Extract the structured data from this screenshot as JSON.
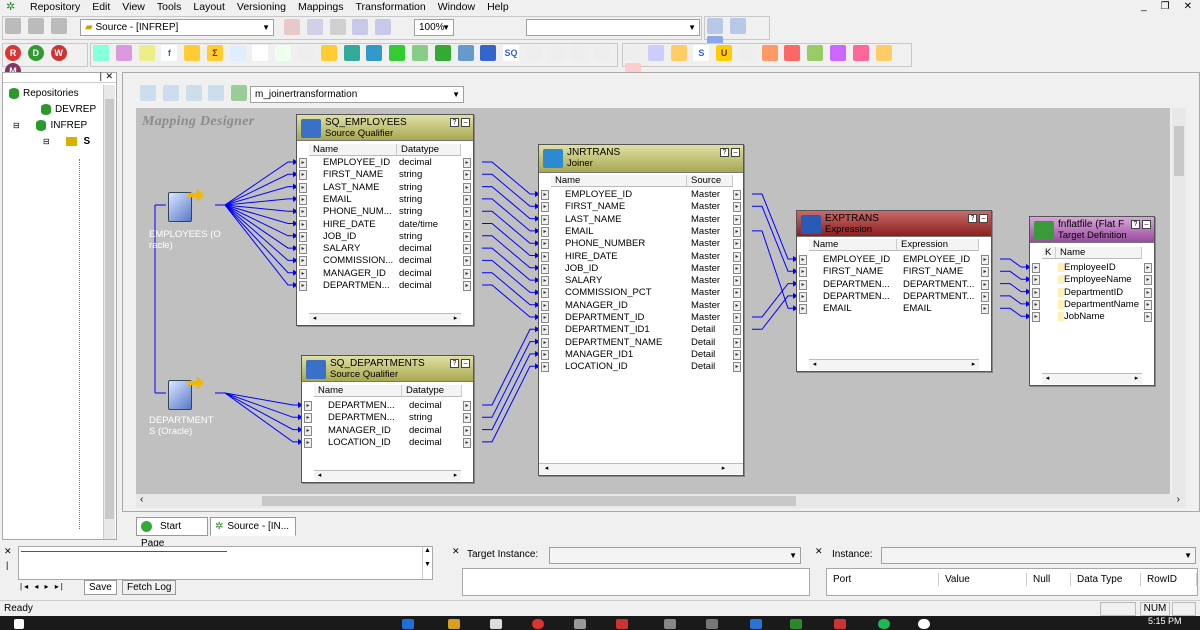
{
  "menu": [
    "Repository",
    "Edit",
    "View",
    "Tools",
    "Layout",
    "Versioning",
    "Mappings",
    "Transformation",
    "Window",
    "Help"
  ],
  "toolbar": {
    "source_combo": "Source - [INFREP]",
    "zoom_combo": "100%",
    "mapping_combo": "m_joinertransformation"
  },
  "nav": {
    "root": "Repositories",
    "items": [
      "DEVREP",
      "INFREP",
      "S"
    ]
  },
  "designer": {
    "title": "Mapping Designer",
    "sources": [
      {
        "label_lines": [
          "EMPLOYEES (O",
          "racle)"
        ]
      },
      {
        "label_lines": [
          "DEPARTMENT",
          "S (Oracle)"
        ]
      }
    ],
    "sq_employees": {
      "title": "SQ_EMPLOYEES",
      "subtitle": "Source Qualifier",
      "col_name": "Name",
      "col_type": "Datatype",
      "rows": [
        [
          "EMPLOYEE_ID",
          "decimal"
        ],
        [
          "FIRST_NAME",
          "string"
        ],
        [
          "LAST_NAME",
          "string"
        ],
        [
          "EMAIL",
          "string"
        ],
        [
          "PHONE_NUM...",
          "string"
        ],
        [
          "HIRE_DATE",
          "date/time"
        ],
        [
          "JOB_ID",
          "string"
        ],
        [
          "SALARY",
          "decimal"
        ],
        [
          "COMMISSION...",
          "decimal"
        ],
        [
          "MANAGER_ID",
          "decimal"
        ],
        [
          "DEPARTMEN...",
          "decimal"
        ]
      ]
    },
    "sq_departments": {
      "title": "SQ_DEPARTMENTS",
      "subtitle": "Source Qualifier",
      "col_name": "Name",
      "col_type": "Datatype",
      "rows": [
        [
          "DEPARTMEN...",
          "decimal"
        ],
        [
          "DEPARTMEN...",
          "string"
        ],
        [
          "MANAGER_ID",
          "decimal"
        ],
        [
          "LOCATION_ID",
          "decimal"
        ]
      ]
    },
    "joiner": {
      "title": "JNRTRANS",
      "subtitle": "Joiner",
      "col_name": "Name",
      "col_type": "Source Ty",
      "rows": [
        [
          "EMPLOYEE_ID",
          "Master"
        ],
        [
          "FIRST_NAME",
          "Master"
        ],
        [
          "LAST_NAME",
          "Master"
        ],
        [
          "EMAIL",
          "Master"
        ],
        [
          "PHONE_NUMBER",
          "Master"
        ],
        [
          "HIRE_DATE",
          "Master"
        ],
        [
          "JOB_ID",
          "Master"
        ],
        [
          "SALARY",
          "Master"
        ],
        [
          "COMMISSION_PCT",
          "Master"
        ],
        [
          "MANAGER_ID",
          "Master"
        ],
        [
          "DEPARTMENT_ID",
          "Master"
        ],
        [
          "DEPARTMENT_ID1",
          "Detail"
        ],
        [
          "DEPARTMENT_NAME",
          "Detail"
        ],
        [
          "MANAGER_ID1",
          "Detail"
        ],
        [
          "LOCATION_ID",
          "Detail"
        ]
      ]
    },
    "expression": {
      "title": "EXPTRANS",
      "subtitle": "Expression",
      "col_name": "Name",
      "col_type": "Expression",
      "rows": [
        [
          "EMPLOYEE_ID",
          "EMPLOYEE_ID"
        ],
        [
          "FIRST_NAME",
          "FIRST_NAME"
        ],
        [
          "DEPARTMEN...",
          "DEPARTMENT..."
        ],
        [
          "DEPARTMEN...",
          "DEPARTMENT..."
        ],
        [
          "EMAIL",
          "EMAIL"
        ]
      ]
    },
    "target": {
      "title": "fnflatfile (Flat Fi",
      "subtitle": "Target Definition",
      "col_k": "K",
      "col_name": "Name",
      "rows": [
        "EmployeeID",
        "EmployeeName",
        "DepartmentID",
        "DepartmentName",
        "JobName"
      ]
    }
  },
  "tabs": [
    "Start Page",
    "Source - [IN..."
  ],
  "output": {
    "tabs": [
      "Save",
      "Fetch Log"
    ]
  },
  "target_instance": {
    "label": "Target Instance:"
  },
  "instance": {
    "label": "Instance:",
    "columns": [
      "Port",
      "Value",
      "Null",
      "Data Type",
      "RowID"
    ]
  },
  "status": {
    "text": "Ready",
    "num": "NUM",
    "clock": "5:15 PM"
  }
}
